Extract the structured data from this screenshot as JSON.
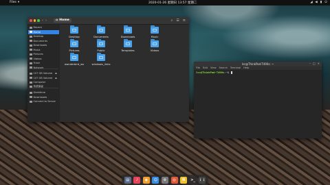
{
  "topbar": {
    "app_menu_label": "Files",
    "clock": "2020-01-26 星期日 13:57 星期二",
    "tray_icons": [
      "network-icon",
      "volume-icon",
      "battery-icon",
      "power-icon"
    ]
  },
  "files": {
    "path_label": "Home",
    "sidebar": [
      {
        "label": "Recent",
        "icon": "clock-icon",
        "selected": false
      },
      {
        "label": "Home",
        "icon": "home-icon",
        "selected": true
      },
      {
        "label": "Desktop",
        "icon": "desktop-icon",
        "selected": false
      },
      {
        "label": "Documents",
        "icon": "document-icon",
        "selected": false
      },
      {
        "label": "Downloads",
        "icon": "download-icon",
        "selected": false
      },
      {
        "label": "Music",
        "icon": "music-icon",
        "selected": false
      },
      {
        "label": "Pictures",
        "icon": "picture-icon",
        "selected": false
      },
      {
        "label": "Videos",
        "icon": "video-icon",
        "selected": false
      },
      {
        "label": "Trash",
        "icon": "trash-icon",
        "selected": false
      },
      {
        "label": "Network",
        "icon": "network-icon",
        "selected": false
      },
      {
        "label": "107 GB Volume",
        "icon": "drive-icon",
        "selected": false,
        "eject": "⏏"
      },
      {
        "label": "107 GB Volume",
        "icon": "drive-icon",
        "selected": false,
        "eject": "⏏"
      },
      {
        "label": "Computer",
        "icon": "computer-icon",
        "selected": false
      },
      {
        "label": "系统保留",
        "icon": "drive-icon",
        "selected": false
      },
      {
        "label": "Geektime",
        "icon": "folder-icon",
        "selected": false
      },
      {
        "label": "Downloads",
        "icon": "folder-icon",
        "selected": false
      },
      {
        "label": "Connect to Server",
        "icon": "server-icon",
        "selected": false
      }
    ],
    "folders": [
      {
        "label": "Desktop"
      },
      {
        "label": "Documents"
      },
      {
        "label": "Downloads"
      },
      {
        "label": "Music"
      },
      {
        "label": "Pictures"
      },
      {
        "label": "Public"
      },
      {
        "label": "Templates"
      },
      {
        "label": "Videos"
      },
      {
        "label": "wanderbird_ws"
      },
      {
        "label": "windows_links"
      }
    ]
  },
  "terminal": {
    "title": "lsc@ThinkPad-T490s: ~",
    "menu": [
      "File",
      "Edit",
      "View",
      "Search",
      "Terminal",
      "Help"
    ],
    "prompt_user": "lsc@ThinkPad-T490s",
    "prompt_path": ":~",
    "prompt_suffix": "$ "
  },
  "dock": [
    {
      "name": "files-app-icon",
      "glyph": "▤",
      "color": "#5a6b8a"
    },
    {
      "name": "music-app-icon",
      "glyph": "♪",
      "color": "#e7445a"
    },
    {
      "name": "photos-app-icon",
      "glyph": "◉",
      "color": "#f0a030"
    },
    {
      "name": "finder-app-icon",
      "glyph": "☺",
      "color": "#3a8de0"
    },
    {
      "name": "settings-app-icon",
      "glyph": "⚙",
      "color": "#7a7a7a"
    },
    {
      "name": "chrome-app-icon",
      "glyph": "◎",
      "color": "#e05a3a"
    },
    {
      "name": "notes-app-icon",
      "glyph": "N",
      "color": "#f2c230"
    },
    {
      "name": "terminal-app-icon",
      "glyph": ">_",
      "color": "#2e2e2e"
    },
    {
      "name": "apps-grid-icon",
      "glyph": "⋮⋮",
      "color": "#444444"
    }
  ]
}
